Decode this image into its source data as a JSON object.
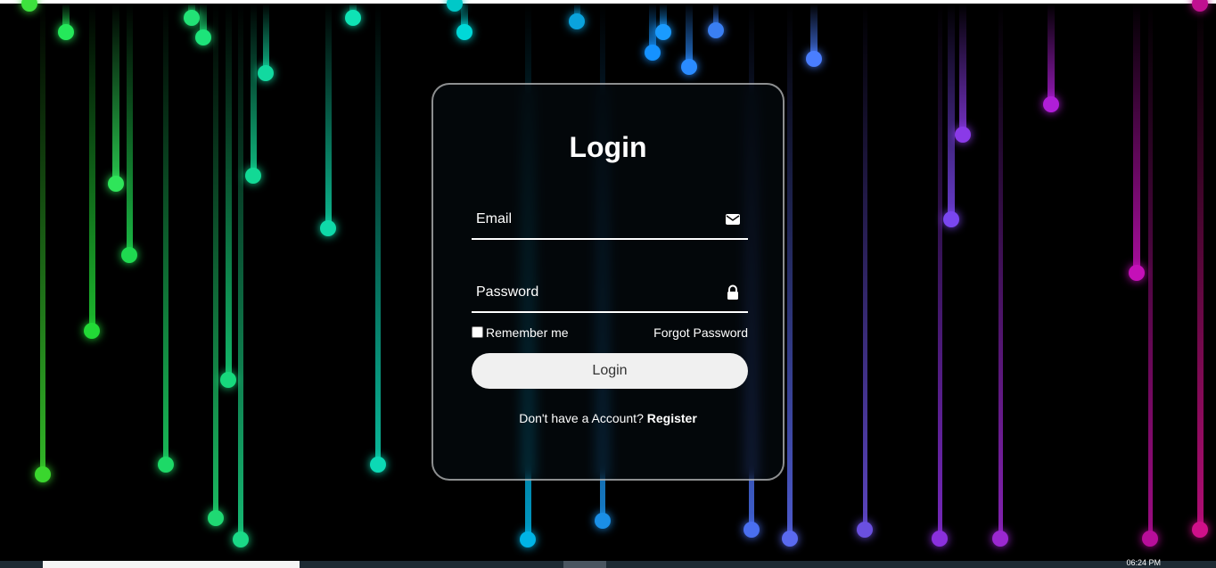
{
  "login": {
    "title": "Login",
    "email_label": "Email",
    "password_label": "Password",
    "remember_label": "Remember me",
    "forgot_label": "Forgot Password",
    "button_label": "Login",
    "register_prompt": "Don't have a Account?",
    "register_link": "Register"
  },
  "icons": {
    "email": "envelope-icon",
    "password": "lock-icon"
  },
  "taskbar": {
    "clock": "06:24 PM"
  },
  "colors": {
    "background": "#000000",
    "button": "#f0f0f0",
    "text": "#ffffff"
  }
}
